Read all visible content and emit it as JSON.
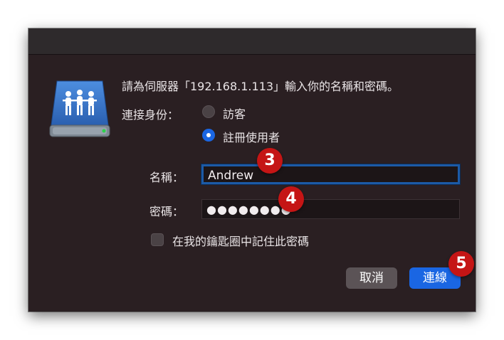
{
  "dialog": {
    "prompt": "請為伺服器「192.168.1.113」輸入你的名稱和密碼。",
    "connect_as_label": "連接身份：",
    "guest_option": "訪客",
    "registered_option": "註冊使用者",
    "selected_option": "註冊使用者",
    "name_label": "名稱：",
    "name_value": "Andrew",
    "password_label": "密碼：",
    "password_value": "●●●●●●●●",
    "remember_label": "在我的鑰匙圈中記住此密碼",
    "remember_checked": false,
    "cancel_label": "取消",
    "connect_label": "連線"
  },
  "annotations": {
    "badge3": "3",
    "badge4": "4",
    "badge5": "5"
  },
  "colors": {
    "dialog_bg": "#2a1f22",
    "accent": "#1a66e3",
    "badge": "#c51515"
  },
  "icons": {
    "server": "shared-network-server-icon"
  }
}
